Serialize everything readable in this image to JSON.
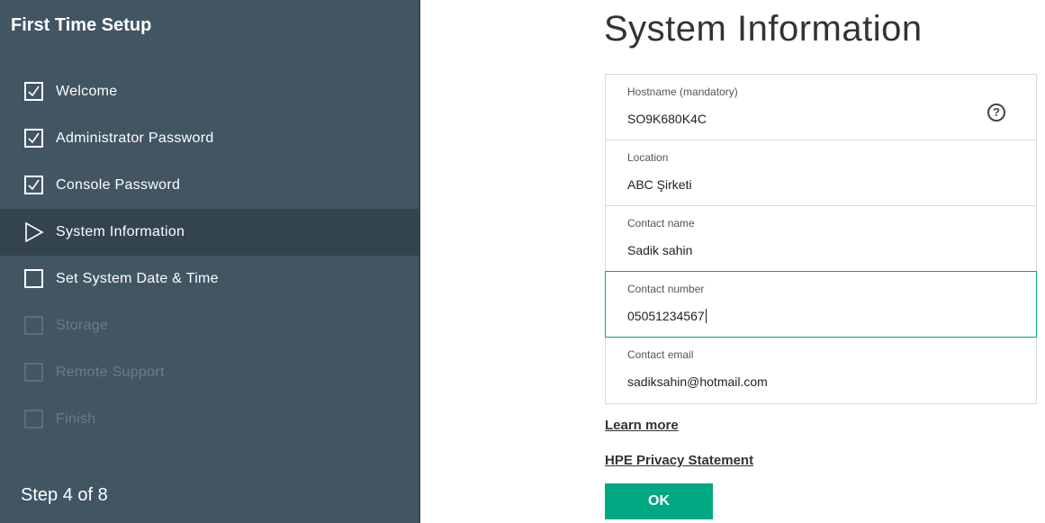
{
  "sidebar": {
    "title": "First Time Setup",
    "steps": [
      {
        "label": "Welcome",
        "state": "done"
      },
      {
        "label": "Administrator Password",
        "state": "done"
      },
      {
        "label": "Console Password",
        "state": "done"
      },
      {
        "label": "System Information",
        "state": "current"
      },
      {
        "label": "Set System Date & Time",
        "state": "pending"
      },
      {
        "label": "Storage",
        "state": "disabled"
      },
      {
        "label": "Remote Support",
        "state": "disabled"
      },
      {
        "label": "Finish",
        "state": "disabled"
      }
    ],
    "step_counter": "Step 4 of 8"
  },
  "main": {
    "title": "System Information",
    "fields": {
      "hostname": {
        "label": "Hostname (mandatory)",
        "value": "SO9K680K4C"
      },
      "location": {
        "label": "Location",
        "value": "ABC Şirketi"
      },
      "contact_name": {
        "label": "Contact name",
        "value": "Sadik sahin"
      },
      "contact_number": {
        "label": "Contact number",
        "value": "05051234567"
      },
      "contact_email": {
        "label": "Contact email",
        "value": "sadiksahin@hotmail.com"
      }
    },
    "help_icon": "question-circle-icon",
    "learn_more": "Learn more",
    "privacy": "HPE Privacy Statement",
    "ok_label": "OK"
  },
  "colors": {
    "sidebar_bg": "#425563",
    "sidebar_current": "#34444f",
    "accent": "#01a982"
  }
}
